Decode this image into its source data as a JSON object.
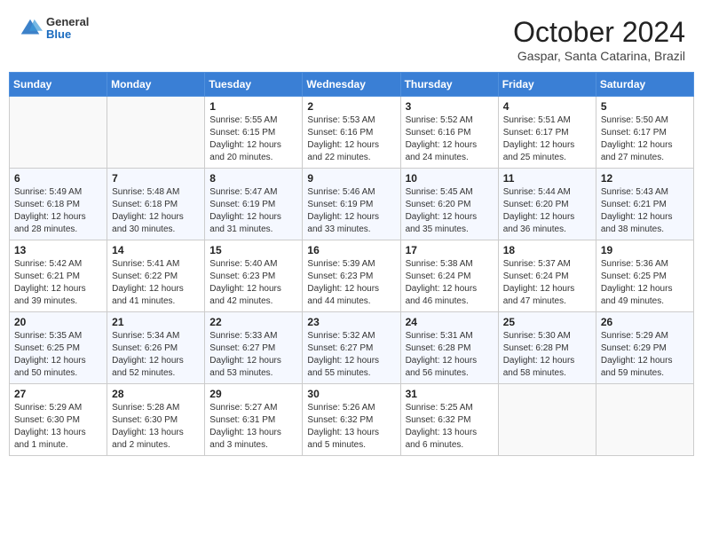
{
  "header": {
    "logo_general": "General",
    "logo_blue": "Blue",
    "month_title": "October 2024",
    "subtitle": "Gaspar, Santa Catarina, Brazil"
  },
  "days_of_week": [
    "Sunday",
    "Monday",
    "Tuesday",
    "Wednesday",
    "Thursday",
    "Friday",
    "Saturday"
  ],
  "weeks": [
    [
      {
        "day": "",
        "info": ""
      },
      {
        "day": "",
        "info": ""
      },
      {
        "day": "1",
        "info": "Sunrise: 5:55 AM\nSunset: 6:15 PM\nDaylight: 12 hours and 20 minutes."
      },
      {
        "day": "2",
        "info": "Sunrise: 5:53 AM\nSunset: 6:16 PM\nDaylight: 12 hours and 22 minutes."
      },
      {
        "day": "3",
        "info": "Sunrise: 5:52 AM\nSunset: 6:16 PM\nDaylight: 12 hours and 24 minutes."
      },
      {
        "day": "4",
        "info": "Sunrise: 5:51 AM\nSunset: 6:17 PM\nDaylight: 12 hours and 25 minutes."
      },
      {
        "day": "5",
        "info": "Sunrise: 5:50 AM\nSunset: 6:17 PM\nDaylight: 12 hours and 27 minutes."
      }
    ],
    [
      {
        "day": "6",
        "info": "Sunrise: 5:49 AM\nSunset: 6:18 PM\nDaylight: 12 hours and 28 minutes."
      },
      {
        "day": "7",
        "info": "Sunrise: 5:48 AM\nSunset: 6:18 PM\nDaylight: 12 hours and 30 minutes."
      },
      {
        "day": "8",
        "info": "Sunrise: 5:47 AM\nSunset: 6:19 PM\nDaylight: 12 hours and 31 minutes."
      },
      {
        "day": "9",
        "info": "Sunrise: 5:46 AM\nSunset: 6:19 PM\nDaylight: 12 hours and 33 minutes."
      },
      {
        "day": "10",
        "info": "Sunrise: 5:45 AM\nSunset: 6:20 PM\nDaylight: 12 hours and 35 minutes."
      },
      {
        "day": "11",
        "info": "Sunrise: 5:44 AM\nSunset: 6:20 PM\nDaylight: 12 hours and 36 minutes."
      },
      {
        "day": "12",
        "info": "Sunrise: 5:43 AM\nSunset: 6:21 PM\nDaylight: 12 hours and 38 minutes."
      }
    ],
    [
      {
        "day": "13",
        "info": "Sunrise: 5:42 AM\nSunset: 6:21 PM\nDaylight: 12 hours and 39 minutes."
      },
      {
        "day": "14",
        "info": "Sunrise: 5:41 AM\nSunset: 6:22 PM\nDaylight: 12 hours and 41 minutes."
      },
      {
        "day": "15",
        "info": "Sunrise: 5:40 AM\nSunset: 6:23 PM\nDaylight: 12 hours and 42 minutes."
      },
      {
        "day": "16",
        "info": "Sunrise: 5:39 AM\nSunset: 6:23 PM\nDaylight: 12 hours and 44 minutes."
      },
      {
        "day": "17",
        "info": "Sunrise: 5:38 AM\nSunset: 6:24 PM\nDaylight: 12 hours and 46 minutes."
      },
      {
        "day": "18",
        "info": "Sunrise: 5:37 AM\nSunset: 6:24 PM\nDaylight: 12 hours and 47 minutes."
      },
      {
        "day": "19",
        "info": "Sunrise: 5:36 AM\nSunset: 6:25 PM\nDaylight: 12 hours and 49 minutes."
      }
    ],
    [
      {
        "day": "20",
        "info": "Sunrise: 5:35 AM\nSunset: 6:25 PM\nDaylight: 12 hours and 50 minutes."
      },
      {
        "day": "21",
        "info": "Sunrise: 5:34 AM\nSunset: 6:26 PM\nDaylight: 12 hours and 52 minutes."
      },
      {
        "day": "22",
        "info": "Sunrise: 5:33 AM\nSunset: 6:27 PM\nDaylight: 12 hours and 53 minutes."
      },
      {
        "day": "23",
        "info": "Sunrise: 5:32 AM\nSunset: 6:27 PM\nDaylight: 12 hours and 55 minutes."
      },
      {
        "day": "24",
        "info": "Sunrise: 5:31 AM\nSunset: 6:28 PM\nDaylight: 12 hours and 56 minutes."
      },
      {
        "day": "25",
        "info": "Sunrise: 5:30 AM\nSunset: 6:28 PM\nDaylight: 12 hours and 58 minutes."
      },
      {
        "day": "26",
        "info": "Sunrise: 5:29 AM\nSunset: 6:29 PM\nDaylight: 12 hours and 59 minutes."
      }
    ],
    [
      {
        "day": "27",
        "info": "Sunrise: 5:29 AM\nSunset: 6:30 PM\nDaylight: 13 hours and 1 minute."
      },
      {
        "day": "28",
        "info": "Sunrise: 5:28 AM\nSunset: 6:30 PM\nDaylight: 13 hours and 2 minutes."
      },
      {
        "day": "29",
        "info": "Sunrise: 5:27 AM\nSunset: 6:31 PM\nDaylight: 13 hours and 3 minutes."
      },
      {
        "day": "30",
        "info": "Sunrise: 5:26 AM\nSunset: 6:32 PM\nDaylight: 13 hours and 5 minutes."
      },
      {
        "day": "31",
        "info": "Sunrise: 5:25 AM\nSunset: 6:32 PM\nDaylight: 13 hours and 6 minutes."
      },
      {
        "day": "",
        "info": ""
      },
      {
        "day": "",
        "info": ""
      }
    ]
  ]
}
